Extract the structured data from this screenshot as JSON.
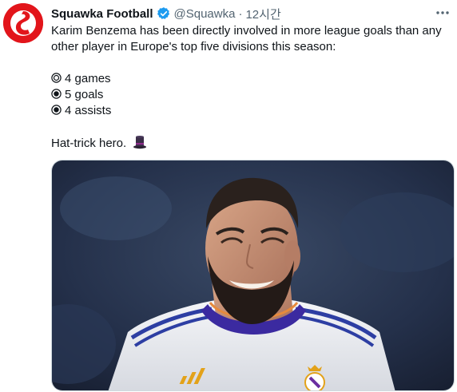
{
  "tweet": {
    "author_name": "Squawka Football",
    "handle": "@Squawka",
    "separator": "·",
    "time": "12시간",
    "verified": true,
    "text_lines": [
      "Karim Benzema has been directly involved in more league goals than any",
      "other player in Europe's top five divisions this season:"
    ],
    "stats": [
      {
        "icon": "concentric-circle-icon",
        "text": "4 games"
      },
      {
        "icon": "radio-button-icon",
        "text": "5 goals"
      },
      {
        "icon": "radio-button-icon",
        "text": "4 assists"
      }
    ],
    "closing": "Hat-trick hero.",
    "closing_emoji": "top-hat-icon"
  },
  "colors": {
    "brand": "#e2151b",
    "verified": "#1d9bf0",
    "text": "#0f1419",
    "muted": "#536471"
  }
}
